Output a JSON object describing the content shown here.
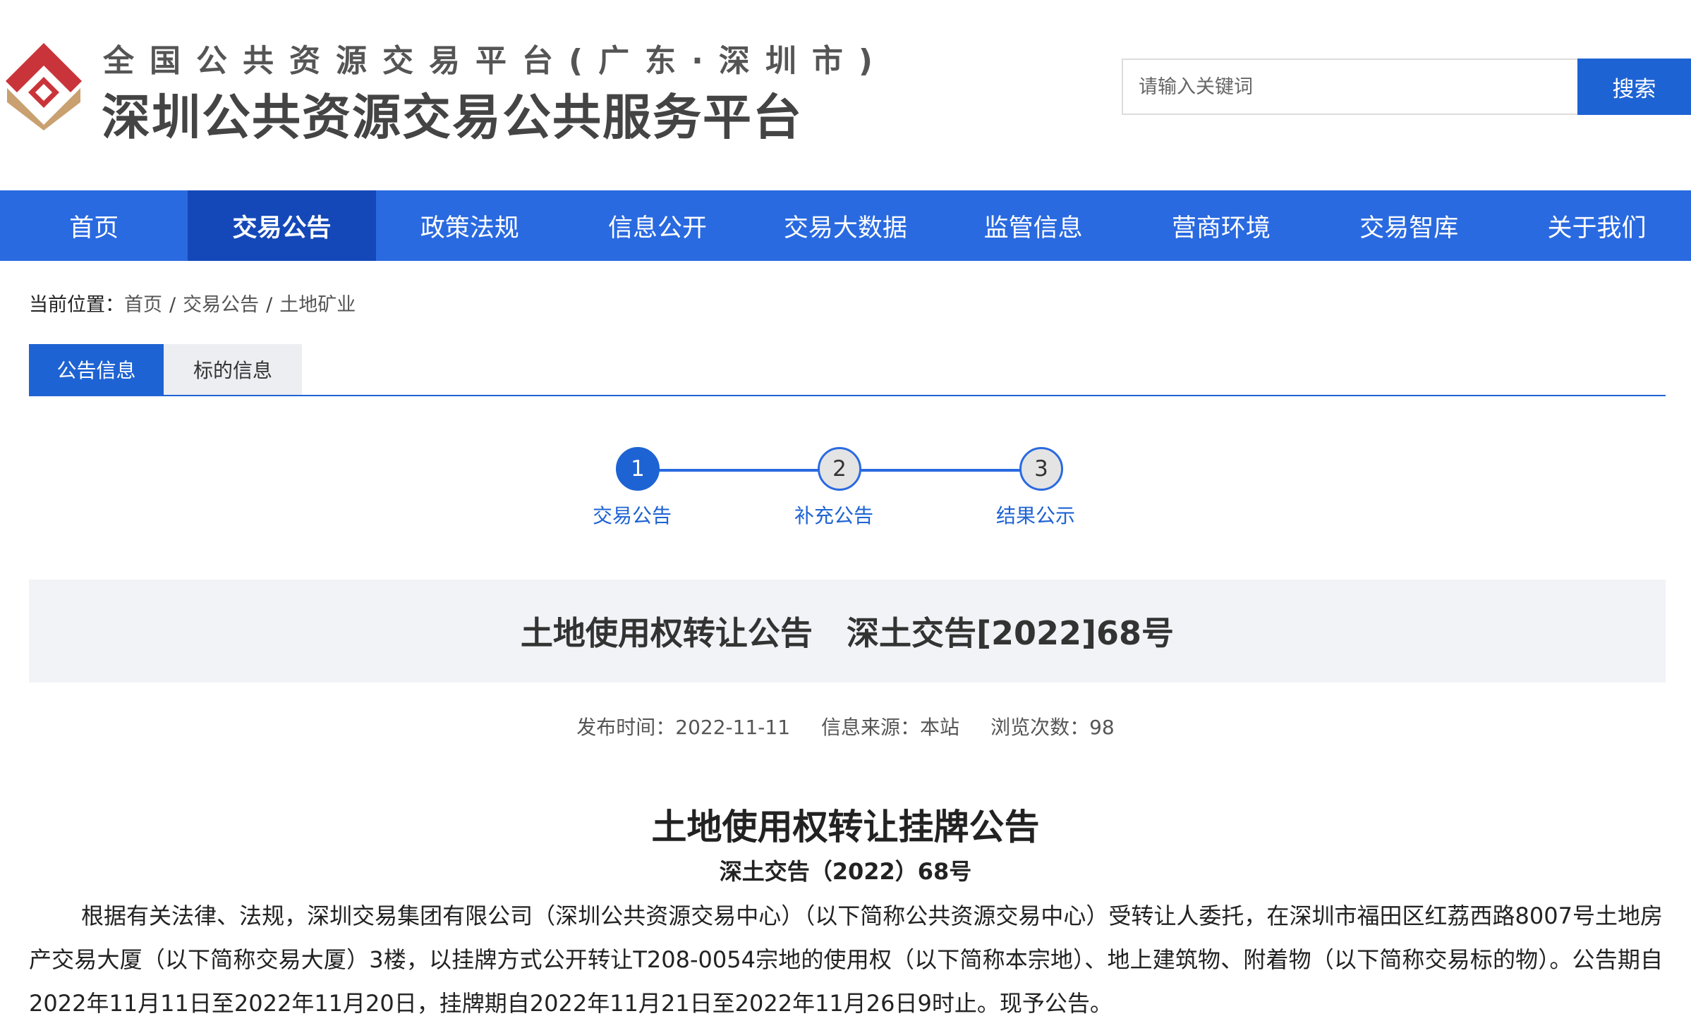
{
  "header": {
    "title_top": "全国公共资源交易平台(广东·深圳市)",
    "title_main": "深圳公共资源交易公共服务平台",
    "search_placeholder": "请输入关键词",
    "search_button": "搜索",
    "colors": {
      "logo_red": "#c9343a",
      "logo_gold": "#c9a070"
    }
  },
  "nav": {
    "items": [
      {
        "label": "首页"
      },
      {
        "label": "交易公告",
        "active": true
      },
      {
        "label": "政策法规"
      },
      {
        "label": "信息公开"
      },
      {
        "label": "交易大数据"
      },
      {
        "label": "监管信息"
      },
      {
        "label": "营商环境"
      },
      {
        "label": "交易智库"
      },
      {
        "label": "关于我们"
      }
    ],
    "colors": {
      "bar": "#2a6ae0",
      "active": "#1448b8"
    }
  },
  "breadcrumb": {
    "label": "当前位置：",
    "items": [
      "首页",
      "交易公告",
      "土地矿业"
    ],
    "separator": "/"
  },
  "tabs": [
    {
      "label": "公告信息",
      "active": true
    },
    {
      "label": "标的信息",
      "active": false
    }
  ],
  "steps": [
    {
      "number": "1",
      "label": "交易公告",
      "state": "active"
    },
    {
      "number": "2",
      "label": "补充公告",
      "state": "pending"
    },
    {
      "number": "3",
      "label": "结果公示",
      "state": "pending"
    }
  ],
  "notice": {
    "title": "土地使用权转让公告   深土交告[2022]68号",
    "meta": {
      "publish_label": "发布时间：",
      "publish_date": "2022-11-11",
      "source_label": "信息来源：",
      "source": "本站",
      "views_label": "浏览次数：",
      "views": "98"
    }
  },
  "document": {
    "title": "土地使用权转让挂牌公告",
    "number": "深土交告（2022）68号",
    "body": "根据有关法律、法规，深圳交易集团有限公司（深圳公共资源交易中心）（以下简称公共资源交易中心）受转让人委托，在深圳市福田区红荔西路8007号土地房产交易大厦（以下简称交易大厦）3楼，以挂牌方式公开转让T208-0054宗地的使用权（以下简称本宗地）、地上建筑物、附着物（以下简称交易标的物）。公告期自2022年11月11日至2022年11月20日，挂牌期自2022年11月21日至2022年11月26日9时止。现予公告。"
  },
  "accent_color": "#1e63d3"
}
